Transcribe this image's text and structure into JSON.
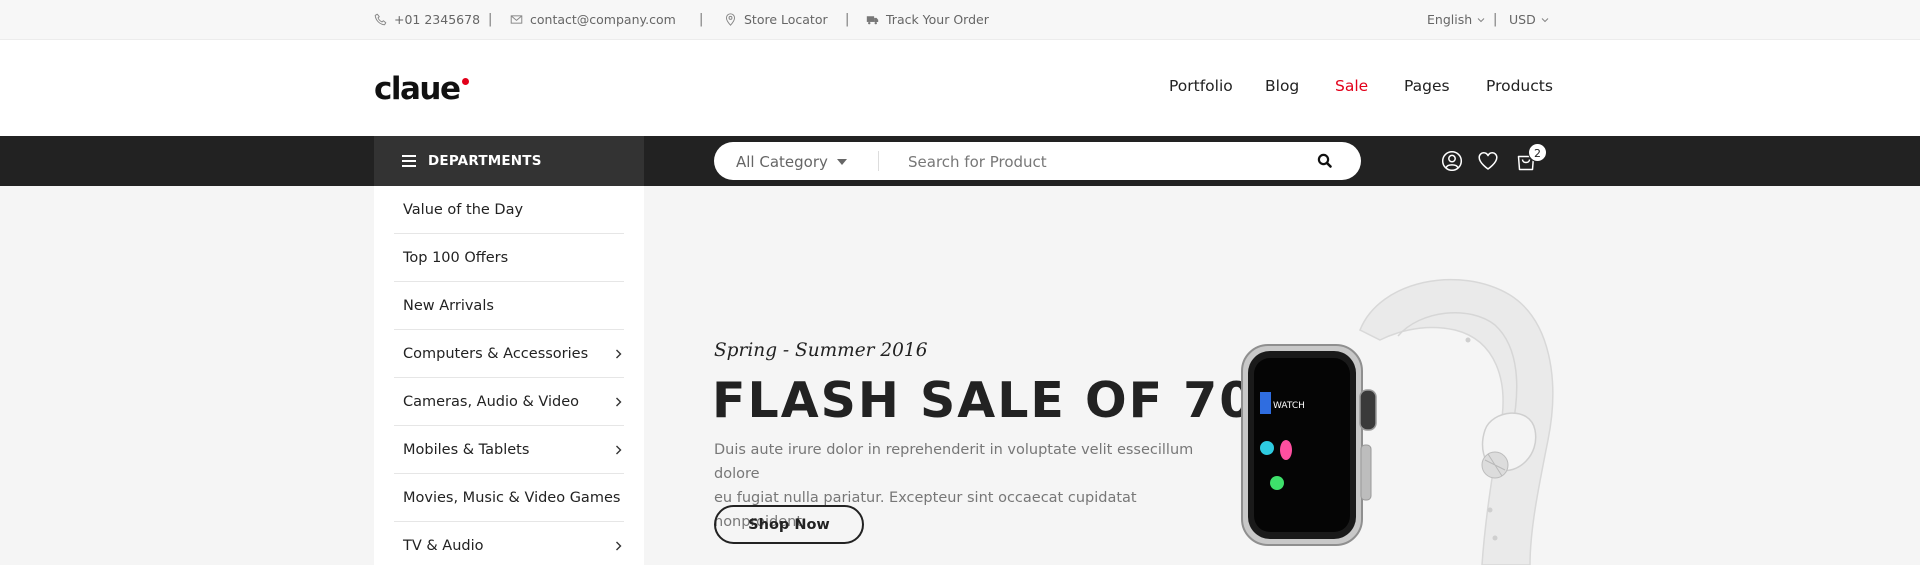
{
  "topbar": {
    "phone": "+01 2345678",
    "email": "contact@company.com",
    "store_locator": "Store Locator",
    "track_order": "Track Your Order",
    "separator": "|",
    "language": "English",
    "currency": "USD"
  },
  "header": {
    "logo": "claue",
    "nav": [
      "Portfolio",
      "Blog",
      "Sale",
      "Pages",
      "Products"
    ],
    "sale_color": "#e2001a"
  },
  "toolbar": {
    "departments_label": "DEPARTMENTS",
    "category_select": "All Category",
    "search_placeholder": "Search for Product",
    "cart_count": "2",
    "icons": [
      "user-icon",
      "heart-icon",
      "cart-icon"
    ]
  },
  "sidebar": {
    "items": [
      {
        "label": "Value of the Day",
        "submenu": false
      },
      {
        "label": "Top 100 Offers",
        "submenu": false
      },
      {
        "label": "New Arrivals",
        "submenu": false
      },
      {
        "label": "Computers & Accessories",
        "submenu": true
      },
      {
        "label": "Cameras, Audio & Video",
        "submenu": true
      },
      {
        "label": "Mobiles & Tablets",
        "submenu": true
      },
      {
        "label": "Movies, Music & Video Games",
        "submenu": false
      },
      {
        "label": "TV & Audio",
        "submenu": true
      }
    ]
  },
  "hero": {
    "subtitle": "Spring - Summer 2016",
    "title": "FLASH SALE OF 70%",
    "line1": "Duis aute irure dolor in reprehenderit in voluptate velit essecillum dolore",
    "line2": "eu fugiat nulla pariatur. Excepteur sint occaecat cupidatat nonproident",
    "button": "Shop Now",
    "watch_screen_label": "WATCH"
  }
}
